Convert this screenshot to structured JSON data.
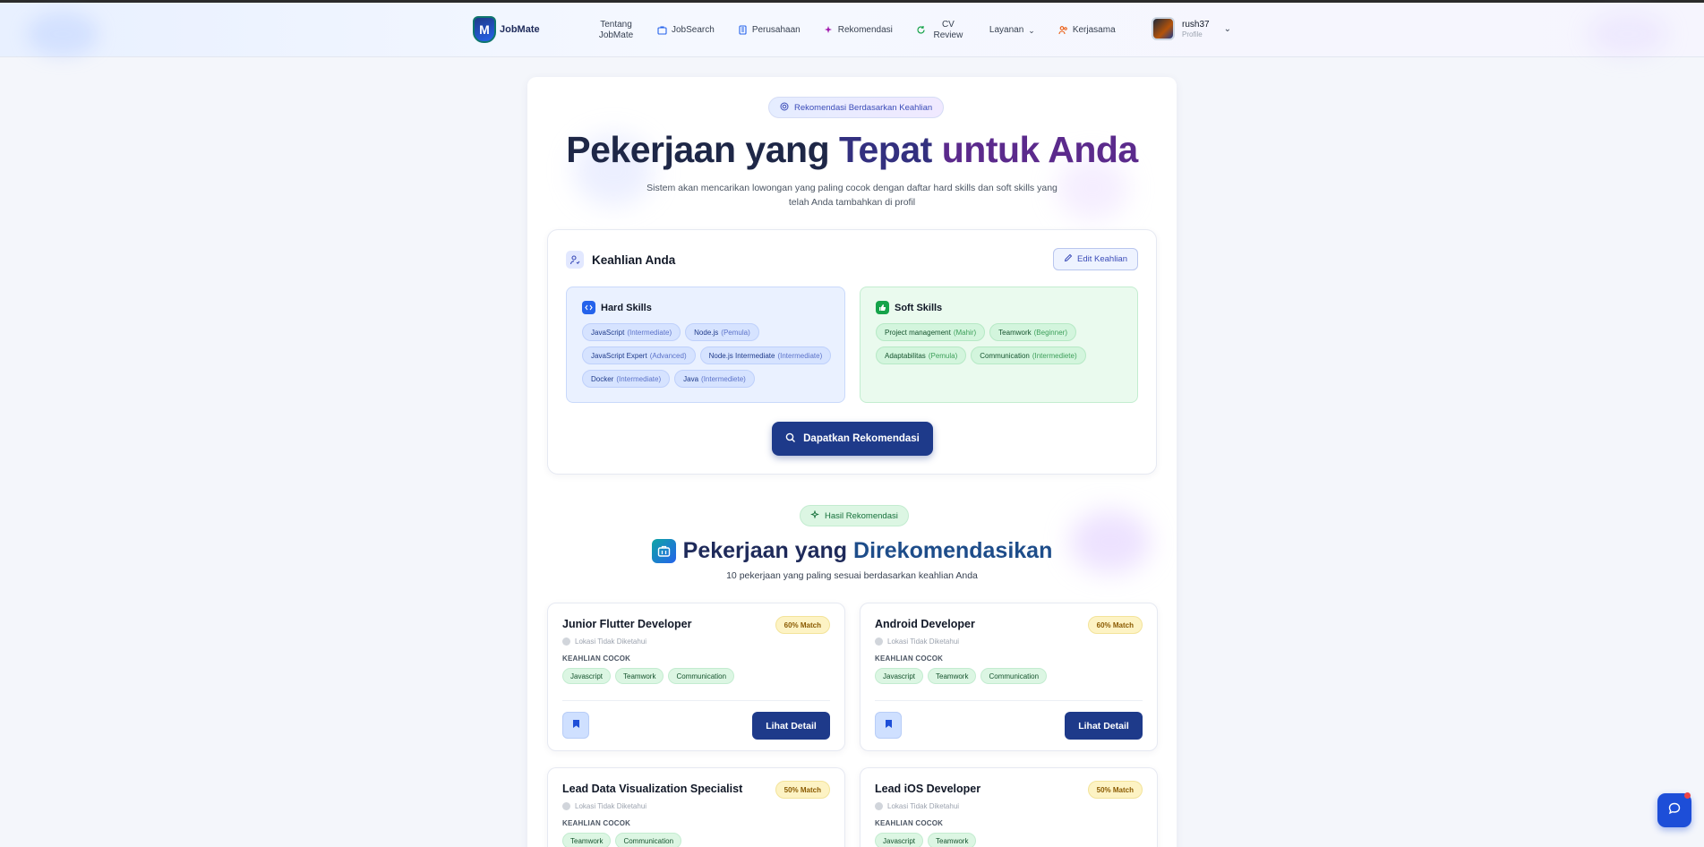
{
  "nav": {
    "logo_text": "JobMate",
    "items": [
      {
        "label": "Tentang JobMate",
        "line1": "Tentang",
        "line2": "JobMate"
      },
      {
        "label": "JobSearch"
      },
      {
        "label": "Perusahaan"
      },
      {
        "label": "Rekomendasi"
      },
      {
        "label": "CV Review",
        "line1": "CV",
        "line2": "Review"
      },
      {
        "label": "Layanan"
      },
      {
        "label": "Kerjasama"
      }
    ],
    "user": {
      "name": "rush37",
      "sub": "Profile"
    }
  },
  "hero": {
    "badge": "Rekomendasi Berdasarkan Keahlian",
    "title_part1": "Pekerjaan yang",
    "title_part2": "Tepat",
    "title_part3": "untuk Anda",
    "subtitle": "Sistem akan mencarikan lowongan yang paling cocok dengan daftar hard skills dan soft skills yang telah Anda tambahkan di profil"
  },
  "skills": {
    "title": "Keahlian Anda",
    "edit_label": "Edit Keahlian",
    "hard_title": "Hard Skills",
    "hard": [
      {
        "name": "JavaScript",
        "level": "(Intermediate)"
      },
      {
        "name": "Node.js",
        "level": "(Pemula)"
      },
      {
        "name": "JavaScript Expert",
        "level": "(Advanced)"
      },
      {
        "name": "Node.js Intermediate",
        "level": "(Intermediate)"
      },
      {
        "name": "Docker",
        "level": "(Intermediate)"
      },
      {
        "name": "Java",
        "level": "(Intermediete)"
      }
    ],
    "soft_title": "Soft Skills",
    "soft": [
      {
        "name": "Project management",
        "level": "(Mahir)"
      },
      {
        "name": "Teamwork",
        "level": "(Beginner)"
      },
      {
        "name": "Adaptabilitas",
        "level": "(Pemula)"
      },
      {
        "name": "Communication",
        "level": "(Intermediete)"
      }
    ],
    "cta": "Dapatkan Rekomendasi"
  },
  "results": {
    "badge": "Hasil Rekomendasi",
    "title_a": "Pekerjaan yang",
    "title_b": "Direkomendasikan",
    "subtitle": "10 pekerjaan yang paling sesuai berdasarkan keahlian Anda",
    "match_label": "KEAHLIAN COCOK",
    "detail_label": "Lihat Detail",
    "jobs": [
      {
        "title": "Junior Flutter Developer",
        "match": "60% Match",
        "location": "Lokasi Tidak Diketahui",
        "skills": [
          "Javascript",
          "Teamwork",
          "Communication"
        ]
      },
      {
        "title": "Android Developer",
        "match": "60% Match",
        "location": "Lokasi Tidak Diketahui",
        "skills": [
          "Javascript",
          "Teamwork",
          "Communication"
        ]
      },
      {
        "title": "Lead Data Visualization Specialist",
        "match": "50% Match",
        "location": "Lokasi Tidak Diketahui",
        "skills": [
          "Teamwork",
          "Communication"
        ]
      },
      {
        "title": "Lead iOS Developer",
        "match": "50% Match",
        "location": "Lokasi Tidak Diketahui",
        "skills": [
          "Javascript",
          "Teamwork"
        ]
      }
    ]
  },
  "colors": {
    "primary": "#1e3a8a",
    "accent_green": "#dcf6e3",
    "match_yellow": "#fdf3c4"
  }
}
